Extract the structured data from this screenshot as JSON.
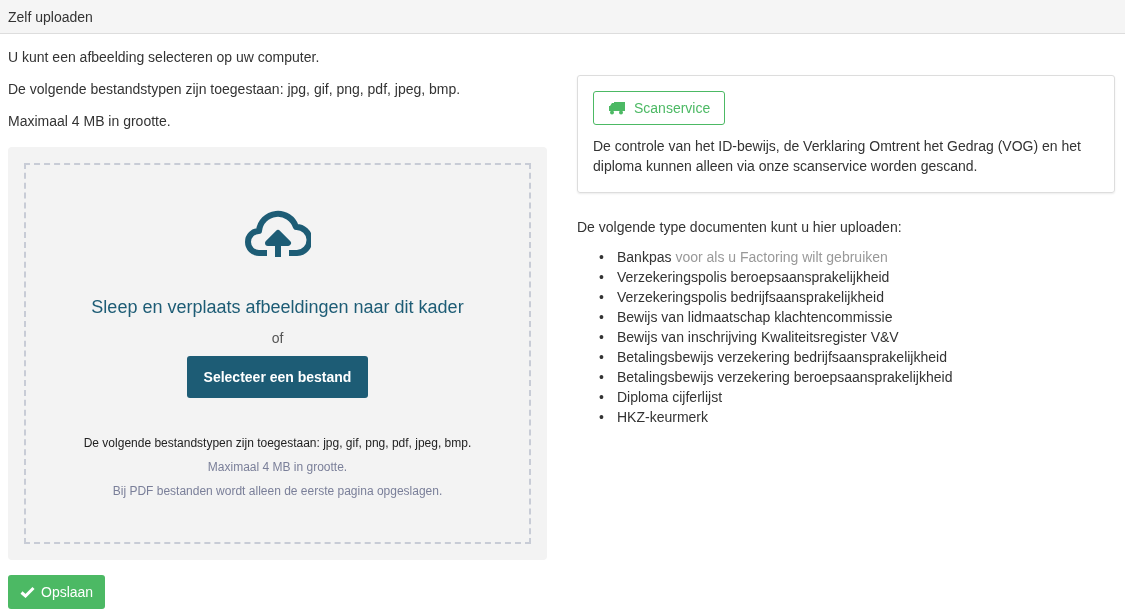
{
  "header": {
    "title": "Zelf uploaden"
  },
  "intro": [
    "U kunt een afbeelding selecteren op uw computer.",
    "De volgende bestandstypen zijn toegestaan: jpg, gif, png, pdf, jpeg, bmp.",
    "Maximaal 4 MB in grootte."
  ],
  "dropzone": {
    "heading": "Sleep en verplaats afbeeldingen naar dit kader",
    "separator": "of",
    "button": "Selecteer een bestand",
    "notes": [
      "De volgende bestandstypen zijn toegestaan: jpg, gif, png, pdf, jpeg, bmp.",
      "Maximaal 4 MB in grootte.",
      "Bij PDF bestanden wordt alleen de eerste pagina opgeslagen."
    ]
  },
  "scan_card": {
    "button": "Scanservice",
    "text": "De controle van het ID-bewijs, de Verklaring Omtrent het Gedrag (VOG) en het diploma kunnen alleen via onze scanservice worden gescand."
  },
  "documents": {
    "heading": "De volgende type documenten kunt u hier uploaden:",
    "items": [
      {
        "marker": "•",
        "text": "Bankpas",
        "note": "voor als u Factoring wilt gebruiken"
      },
      {
        "marker": "•",
        "text": "Verzekeringspolis beroepsaansprakelijkheid"
      },
      {
        "marker": "•",
        "text": "Verzekeringspolis bedrijfsaansprakelijkheid"
      },
      {
        "marker": "•",
        "text": "Bewijs van lidmaatschap klachtencommissie"
      },
      {
        "marker": "•",
        "text": "Bewijs van inschrijving Kwaliteitsregister V&V"
      },
      {
        "marker": "•",
        "text": "Betalingsbewijs verzekering bedrijfsaansprakelijkheid"
      },
      {
        "marker": "•",
        "text": "Betalingsbewijs verzekering beroepsaansprakelijkheid"
      },
      {
        "marker": "•",
        "text": "Diploma cijferlijst"
      },
      {
        "marker": "•",
        "text": "HKZ-keurmerk"
      }
    ]
  },
  "save_button": "Opslaan"
}
